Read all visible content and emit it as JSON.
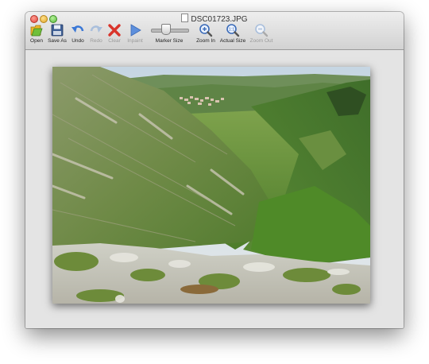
{
  "window": {
    "title": "DSC01723.JPG"
  },
  "toolbar": {
    "items": [
      {
        "label": "Open",
        "icon": "open-folder-icon",
        "enabled": true
      },
      {
        "label": "Save As",
        "icon": "save-disk-icon",
        "enabled": true
      },
      {
        "label": "Undo",
        "icon": "undo-arrow-icon",
        "enabled": true
      },
      {
        "label": "Redo",
        "icon": "redo-arrow-icon",
        "enabled": false
      },
      {
        "label": "Clear",
        "icon": "clear-x-icon",
        "enabled": true
      },
      {
        "label": "Inpaint",
        "icon": "inpaint-play-icon",
        "enabled": false
      },
      {
        "label": "Marker Size",
        "icon": "slider",
        "enabled": true
      },
      {
        "label": "Zoom In",
        "icon": "zoom-in-icon",
        "enabled": true
      },
      {
        "label": "Actual Size",
        "icon": "actual-size-icon",
        "enabled": true
      },
      {
        "label": "Zoom Out",
        "icon": "zoom-out-icon",
        "enabled": false
      }
    ],
    "marker_size_level": 0.4
  },
  "colors": {
    "accent_blue": "#3b78d6",
    "clear_red": "#d9342b",
    "disabled": "#9a9a9a"
  }
}
